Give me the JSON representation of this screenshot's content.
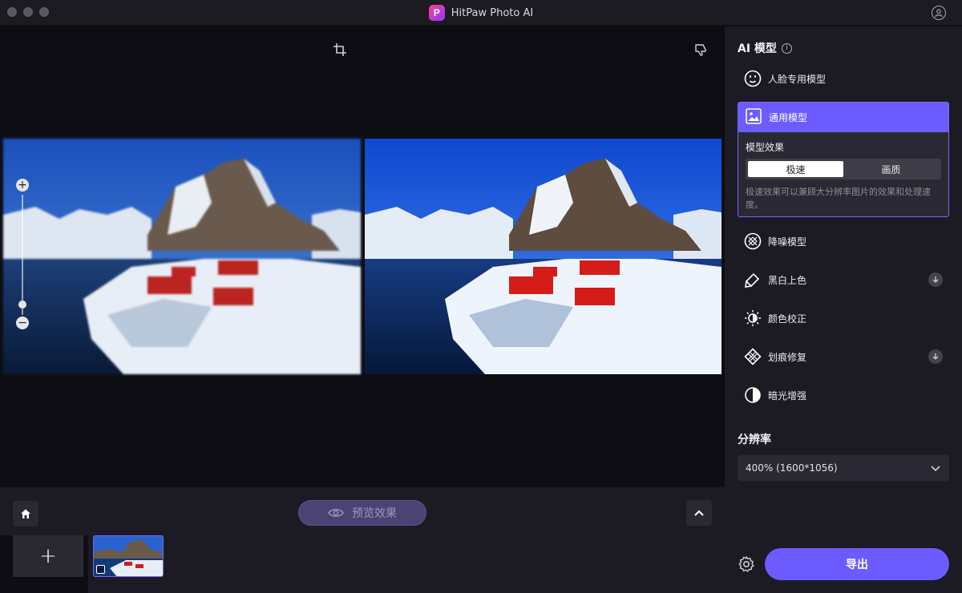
{
  "app": {
    "title": "HitPaw Photo AI",
    "logo_letter": "P",
    "accent_color": "#6c5cff"
  },
  "panel": {
    "ai_model_title": "AI 模型",
    "models": [
      {
        "label": "人脸专用模型",
        "icon": "face-icon"
      },
      {
        "label": "通用模型",
        "icon": "image-icon",
        "selected": true
      },
      {
        "label": "降噪模型",
        "icon": "denoise-icon"
      },
      {
        "label": "黑白上色",
        "icon": "colorize-icon",
        "download": true
      },
      {
        "label": "颜色校正",
        "icon": "sun-icon"
      },
      {
        "label": "划痕修复",
        "icon": "scratch-icon",
        "download": true
      },
      {
        "label": "暗光增强",
        "icon": "contrast-icon"
      }
    ],
    "general": {
      "effect_label": "模型效果",
      "option_fast": "极速",
      "option_quality": "画质",
      "selected_option": "极速",
      "description": "极速效果可以兼顾大分辨率图片的效果和处理速度。"
    },
    "resolution_title": "分辨率",
    "resolution_value": "400% (1600*1056)",
    "export_label": "导出"
  },
  "bottom": {
    "preview_label": "预览效果",
    "add_label": "+"
  },
  "zoom": {
    "in_label": "+",
    "out_label": "−",
    "level": 0.12
  }
}
